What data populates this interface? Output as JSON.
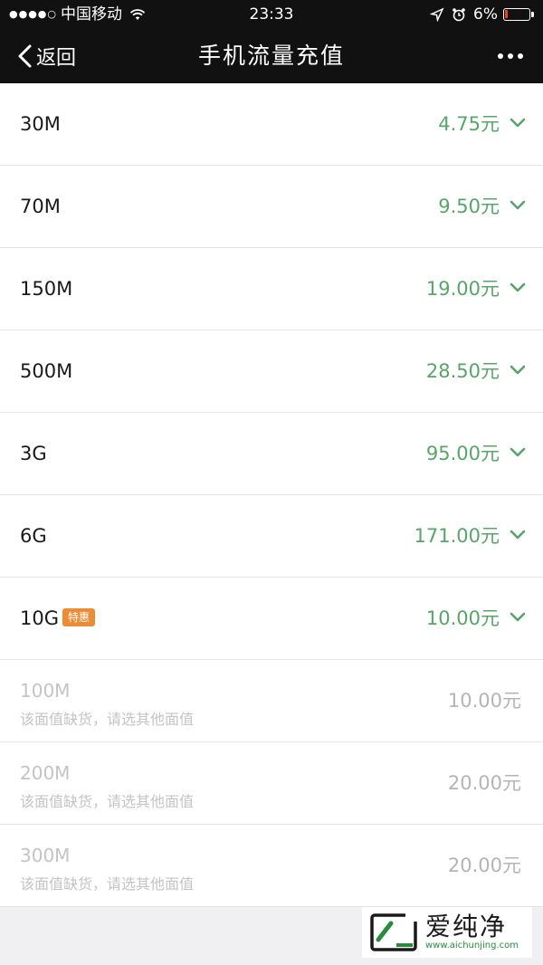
{
  "status_bar": {
    "carrier": "中国移动",
    "time": "23:33",
    "battery": "6%"
  },
  "navbar": {
    "back_label": "返回",
    "title": "手机流量充值"
  },
  "packages": [
    {
      "size": "30M",
      "price": "4.75元"
    },
    {
      "size": "70M",
      "price": "9.50元"
    },
    {
      "size": "150M",
      "price": "19.00元"
    },
    {
      "size": "500M",
      "price": "28.50元"
    },
    {
      "size": "3G",
      "price": "95.00元"
    },
    {
      "size": "6G",
      "price": "171.00元"
    },
    {
      "size": "10G",
      "price": "10.00元",
      "badge": "特惠"
    }
  ],
  "unavailable": [
    {
      "size": "100M",
      "note": "该面值缺货，请选其他面值",
      "price": "10.00元"
    },
    {
      "size": "200M",
      "note": "该面值缺货，请选其他面值",
      "price": "20.00元"
    },
    {
      "size": "300M",
      "note": "该面值缺货，请选其他面值",
      "price": "20.00元"
    }
  ],
  "watermark": {
    "text": "爱纯净",
    "url": "www.aichunjing.com"
  },
  "colors": {
    "price_green": "#5aa36b",
    "badge_orange": "#ec8c36",
    "navbar_bg": "#111111"
  }
}
